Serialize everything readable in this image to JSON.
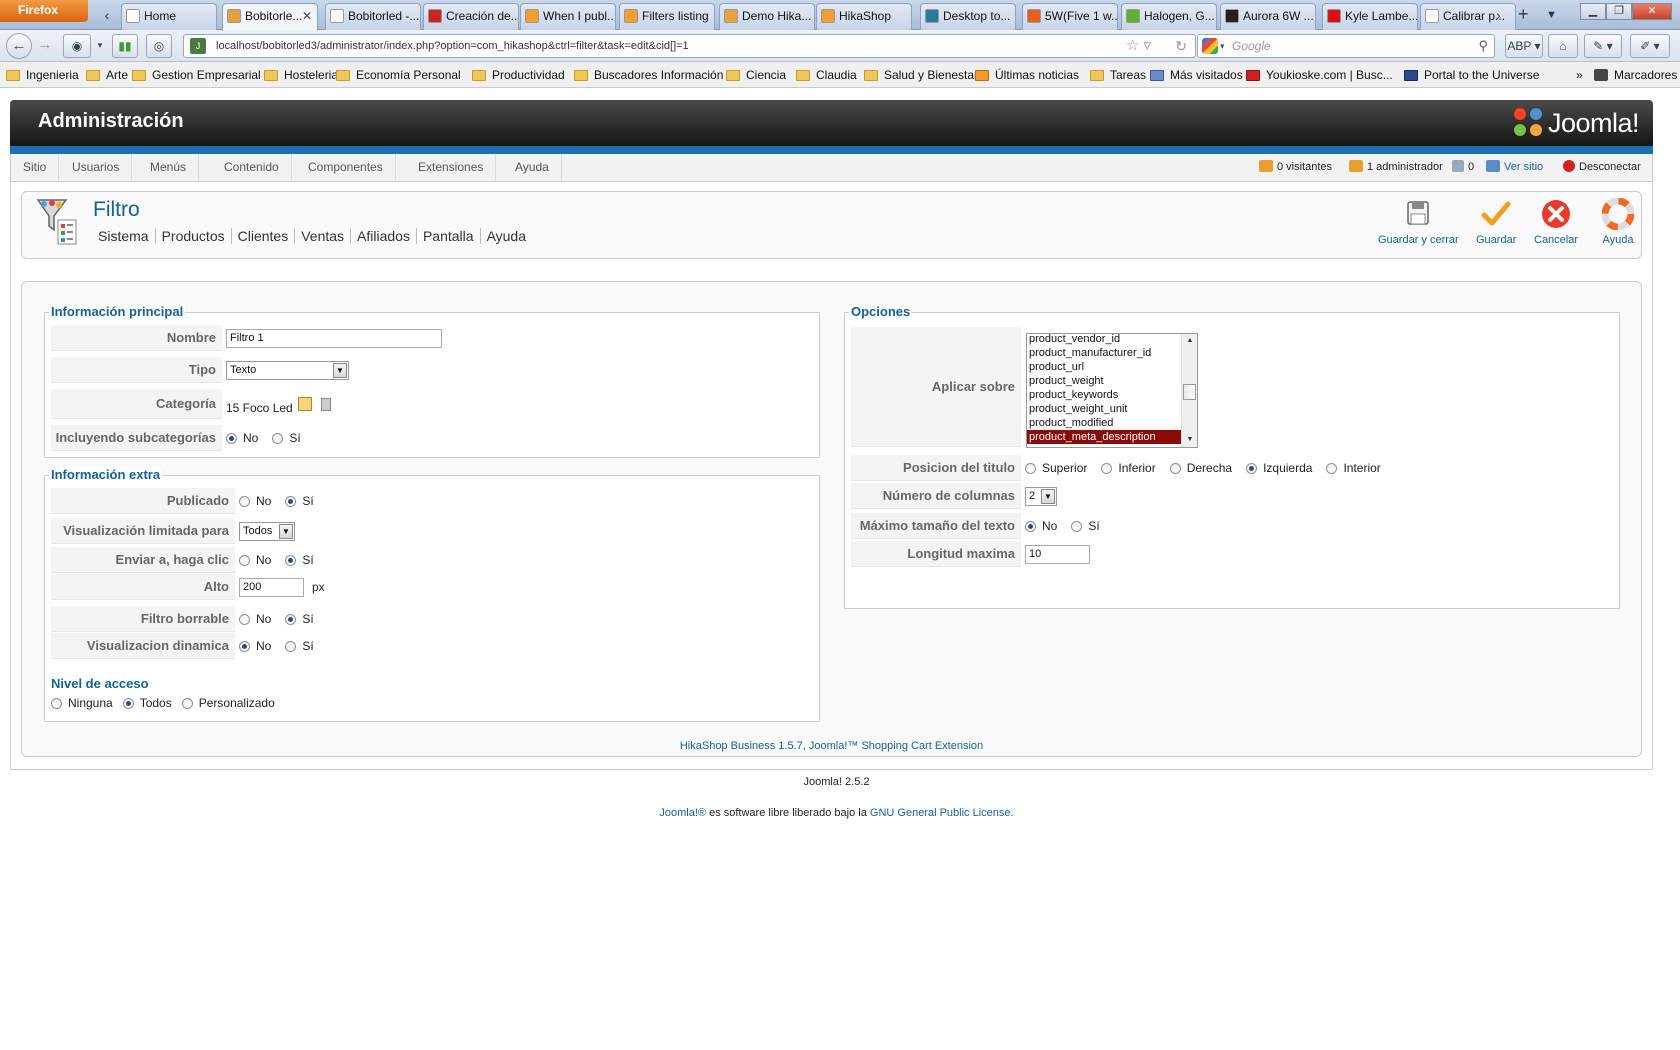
{
  "browser": {
    "app_button": "Firefox",
    "tabs": [
      {
        "title": "Home",
        "color": "#ffffff"
      },
      {
        "title": "Bobitorle...",
        "color": "#e8a040",
        "active": true
      },
      {
        "title": "Bobitorled -...",
        "color": "#ffffff"
      },
      {
        "title": "Creación de...",
        "color": "#cc2222"
      },
      {
        "title": "When I publ...",
        "color": "#f0a030"
      },
      {
        "title": "Filters listing",
        "color": "#f0a030"
      },
      {
        "title": "Demo Hika...",
        "color": "#e8a040"
      },
      {
        "title": "HikaShop",
        "color": "#f0a030"
      },
      {
        "title": "Desktop to...",
        "color": "#2a7a9a"
      },
      {
        "title": "5W(Five 1 w...",
        "color": "#e86020"
      },
      {
        "title": "Halogen, G...",
        "color": "#60b030"
      },
      {
        "title": "Aurora 6W ...",
        "color": "#222222"
      },
      {
        "title": "Kyle Lambe...",
        "color": "#dd1111"
      },
      {
        "title": "Calibrar p...",
        "color": "#ffffff"
      }
    ],
    "url": "localhost/bobitorled3/administrator/index.php?option=com_hikashop&ctrl=filter&task=edit&cid[]=1",
    "search_placeholder": "Google",
    "bookmarks": [
      "Ingenieria",
      "Arte",
      "Gestion Empresarial",
      "Hosteleria",
      "Economía Personal",
      "Productividad",
      "Buscadores Información",
      "Ciencia",
      "Claudia",
      "Salud y Bienestar",
      "Últimas noticias",
      "Tareas",
      "Más visitados",
      "Youkioske.com | Busc...",
      "Portal to the Universe"
    ],
    "bookmarks_more": "»",
    "bookmarks_menu": "Marcadores"
  },
  "joomla": {
    "header_title": "Administración",
    "logo_text": "Joomla!",
    "menu": [
      "Sitio",
      "Usuarios",
      "Menús",
      "Contenido",
      "Componentes",
      "Extensiones",
      "Ayuda"
    ],
    "status": {
      "visitors": "0 visitantes",
      "admins": "1 administrador",
      "messages": "0",
      "view_site": "Ver sitio",
      "logout": "Desconectar"
    }
  },
  "toolbar": {
    "title": "Filtro",
    "submenu": [
      "Sistema",
      "Productos",
      "Clientes",
      "Ventas",
      "Afiliados",
      "Pantalla",
      "Ayuda"
    ],
    "buttons": {
      "save_close": "Guardar y cerrar",
      "save": "Guardar",
      "cancel": "Cancelar",
      "help": "Ayuda"
    }
  },
  "main_info": {
    "legend": "Información principal",
    "name_label": "Nombre",
    "name_value": "Filtro 1",
    "type_label": "Tipo",
    "type_value": "Texto",
    "category_label": "Categoría",
    "category_value": "15 Foco Led",
    "subcat_label": "Incluyendo subcategorías",
    "no": "No",
    "yes": "Sí"
  },
  "extra_info": {
    "legend": "Información extra",
    "published_label": "Publicado",
    "limited_label": "Visualización limitada para",
    "limited_value": "Todos",
    "send_label": "Enviar a, haga clic",
    "height_label": "Alto",
    "height_value": "200",
    "height_unit": "px",
    "deletable_label": "Filtro borrable",
    "dynamic_label": "Visualizacion dinamica",
    "access_title": "Nivel de acceso",
    "access_none": "Ninguna",
    "access_all": "Todos",
    "access_custom": "Personalizado"
  },
  "options": {
    "legend": "Opciones",
    "apply_label": "Aplicar sobre",
    "apply_list": [
      "product_vendor_id",
      "product_manufacturer_id",
      "product_url",
      "product_weight",
      "product_keywords",
      "product_weight_unit",
      "product_modified",
      "product_meta_description"
    ],
    "apply_selected": "product_meta_description",
    "title_pos_label": "Posicion del titulo",
    "pos_superior": "Superior",
    "pos_inferior": "Inferior",
    "pos_derecha": "Derecha",
    "pos_izquierda": "Izquierda",
    "pos_interior": "Interior",
    "columns_label": "Número de columnas",
    "columns_value": "2",
    "max_size_label": "Máximo tamaño del texto",
    "max_len_label": "Longitud maxima",
    "max_len_value": "10"
  },
  "footer": {
    "hikashop": "HikaShop Business 1.5.7, Joomla!™ Shopping Cart Extension",
    "version": "Joomla! 2.5.2",
    "license_link1": "Joomla!®",
    "license_text": " es software libre liberado bajo la ",
    "license_link2": "GNU General Public License."
  }
}
